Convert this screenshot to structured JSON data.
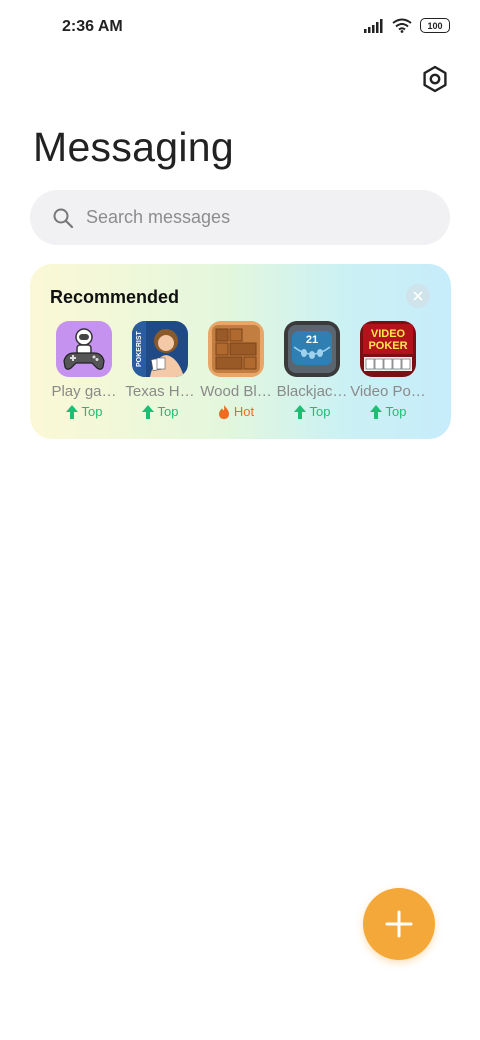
{
  "status": {
    "time": "2:36 AM",
    "battery": "100"
  },
  "header": {
    "title": "Messaging",
    "settings_icon": "settings-icon"
  },
  "search": {
    "placeholder": "Search messages"
  },
  "recommended": {
    "title": "Recommended",
    "apps": [
      {
        "name": "Play ga…",
        "badge": "Top",
        "badge_type": "top"
      },
      {
        "name": "Texas H…",
        "badge": "Top",
        "badge_type": "top"
      },
      {
        "name": "Wood Bl…",
        "badge": "Hot",
        "badge_type": "hot"
      },
      {
        "name": "Blackjac…",
        "badge": "Top",
        "badge_type": "top"
      },
      {
        "name": "Video Po…",
        "badge": "Top",
        "badge_type": "top"
      }
    ],
    "icon_texts": {
      "pokerist": "POKERIST",
      "blackjack": "21",
      "video_poker_1": "VIDEO",
      "video_poker_2": "POKER"
    }
  },
  "colors": {
    "accent": "#f5a83a",
    "top": "#1bbf73",
    "hot": "#ef6b20"
  }
}
